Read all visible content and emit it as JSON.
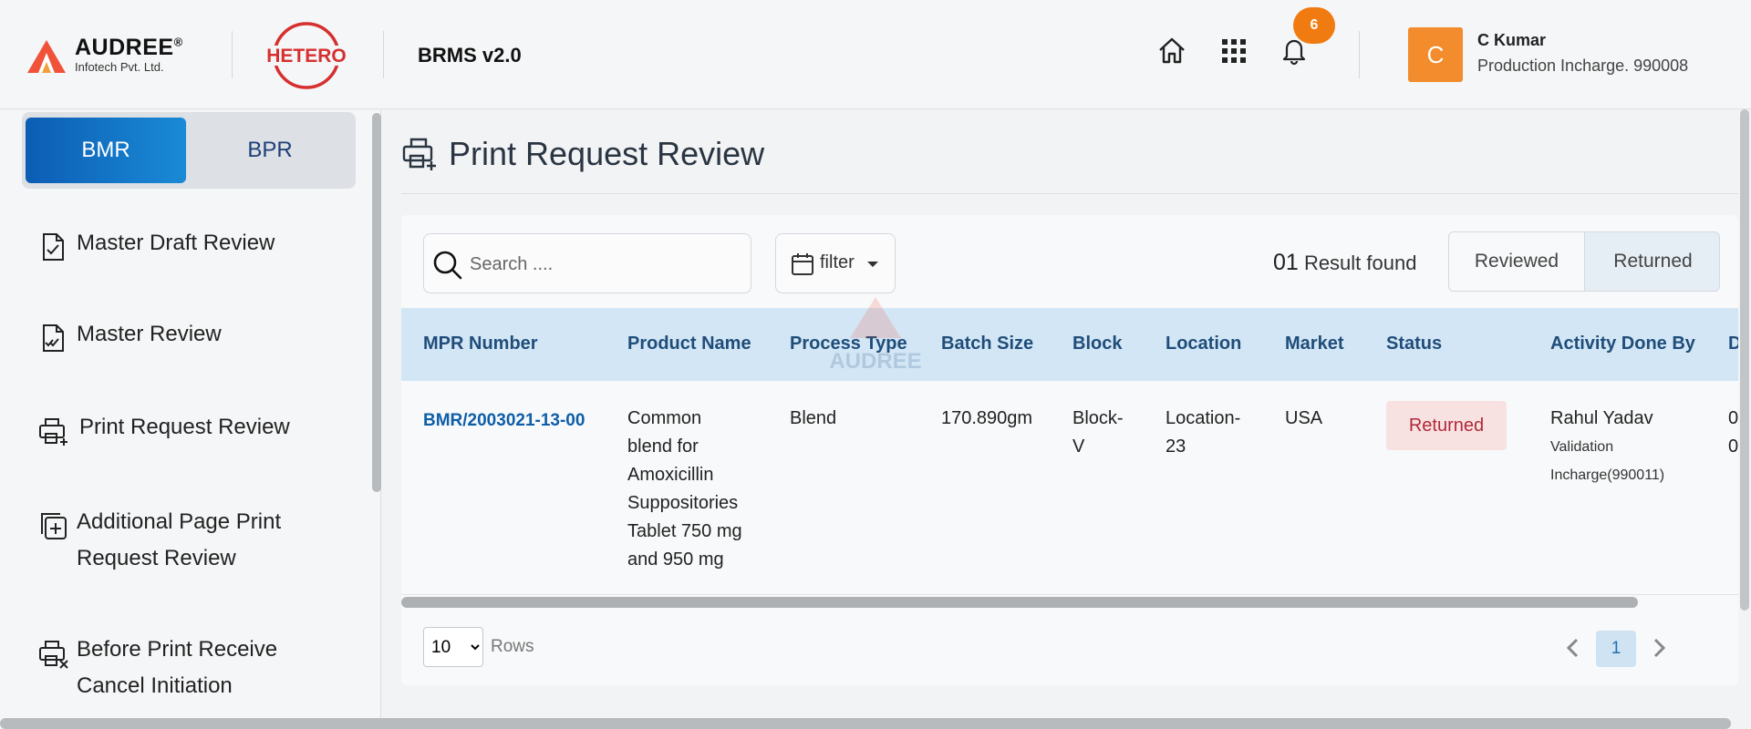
{
  "header": {
    "brand_name": "AUDREE",
    "brand_registered": "®",
    "brand_sub": "Infotech Pvt. Ltd.",
    "client_logo": "HETERO",
    "app_title": "BRMS v2.0",
    "notification_count": "6",
    "user": {
      "initial": "C",
      "name": "C Kumar",
      "role": "Production Incharge. 990008"
    },
    "icons": [
      "home-icon",
      "apps-grid-icon",
      "bell-icon"
    ]
  },
  "sidebar": {
    "toggle": {
      "active": "BMR",
      "inactive": "BPR"
    },
    "items": [
      {
        "label": "Master Draft Review",
        "icon": "document-check-icon"
      },
      {
        "label": "Master Review",
        "icon": "document-double-check-icon"
      },
      {
        "label": "Print Request Review",
        "icon": "printer-plus-icon"
      },
      {
        "label": "Additional Page Print Request Review",
        "icon": "copy-plus-icon"
      },
      {
        "label": "Before Print Receive Cancel Initiation",
        "icon": "printer-x-icon"
      }
    ]
  },
  "page": {
    "title": "Print Request Review",
    "search_placeholder": "Search ....",
    "filter_label": "filter",
    "result_count": "01",
    "result_text": "Result found",
    "segments": [
      "Reviewed",
      "Returned"
    ],
    "selected_segment": "Returned"
  },
  "table": {
    "columns": [
      "MPR Number",
      "Product Name",
      "Process Type",
      "Batch Size",
      "Block",
      "Location",
      "Market",
      "Status",
      "Activity Done By",
      "D"
    ],
    "rows": [
      {
        "mpr_number": "BMR/2003021-13-00",
        "product_lines": [
          "Common",
          "blend for",
          "Amoxicillin",
          "Suppositories",
          "Tablet 750 mg",
          "and 950 mg"
        ],
        "process_type": "Blend",
        "batch_size": "170.890gm",
        "block_lines": [
          "Block-",
          "V"
        ],
        "location_lines": [
          "Location-",
          "23"
        ],
        "market": "USA",
        "status": "Returned",
        "activity_name": "Rahul Yadav",
        "activity_role_lines": [
          "Validation",
          "Incharge(990011)"
        ],
        "date_partial_lines": [
          "0",
          "0"
        ]
      }
    ],
    "watermark": "AUDREE"
  },
  "footer": {
    "rows_value": "10",
    "rows_label": "Rows",
    "current_page": "1"
  },
  "colors": {
    "primary": "#0c5db4",
    "header_row": "#d3e6f5",
    "status_returned_bg": "#f8e1e1",
    "status_returned_text": "#b02a3a",
    "avatar": "#f28c2c",
    "badge": "#f07b10"
  }
}
